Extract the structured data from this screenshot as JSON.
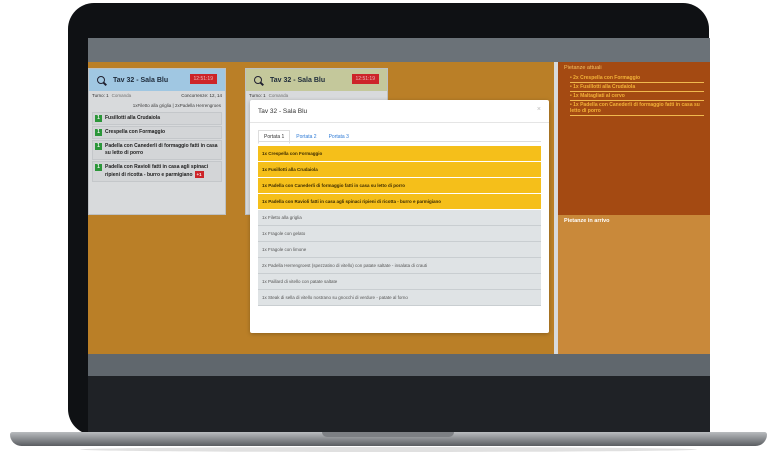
{
  "left_card": {
    "title": "Tav 32 - Sala Blu",
    "time_badge": "12:51:19",
    "turno": "Turno: 1",
    "comanda": "Comanda",
    "concorrenze": "Concorrenze: 12, 14",
    "summary": "1xFiletto alla griglia | 2xPadella Herrengroes",
    "dishes": [
      {
        "qty": "1",
        "name": "Fusillotti alla Crudaiola"
      },
      {
        "qty": "1",
        "name": "Crespella con Formaggio"
      },
      {
        "qty": "1",
        "name": "Padella con Canederli di formaggio fatti in casa su letto di porro"
      },
      {
        "qty": "1",
        "name": "Padella con Ravioli fatti in casa agli spinaci ripieni di ricotta - burro e parmigiano",
        "badge": "+1"
      }
    ]
  },
  "mid_card": {
    "title": "Tav 32 - Sala Blu",
    "time_badge": "12:51:19",
    "turno": "Turno: 1",
    "comanda": "Comanda"
  },
  "right_panel": {
    "attuali_title": "Pietanze attuali",
    "attuali_items": [
      "2x Crespella con Formaggio",
      "1x Fusillotti alla Crudaiola",
      "1x Maltagliati al cervo",
      "1x Padella con Canederli di formaggio fatti in casa su letto di porro"
    ],
    "arrivo_title": "Pietanze in arrivo"
  },
  "modal": {
    "title": "Tav 32 - Sala Blu",
    "close": "×",
    "tabs": [
      "Portata 1",
      "Portata 2",
      "Portata 3"
    ],
    "rows": [
      {
        "text": "1x Crespella con Formaggio",
        "highlight": true
      },
      {
        "text": "1x Fusillotti alla Crudaiola",
        "highlight": true
      },
      {
        "text": "1x Padella con Canederli di formaggio fatti in casa su letto di porro",
        "highlight": true
      },
      {
        "text": "1x Padella con Ravioli fatti in casa agli spinaci ripieni di ricotta - burro e parmigiano",
        "highlight": true
      },
      {
        "text": "1x Filetto alla griglia",
        "highlight": false
      },
      {
        "text": "1x Fragole con gelato",
        "highlight": false
      },
      {
        "text": "1x Fragole con limone",
        "highlight": false
      },
      {
        "text": "2x Padella Herrengroest (spezzatino di vitello) con patate saltate - insalata di crauti",
        "highlight": false
      },
      {
        "text": "1x Paillard di vitello con patate saltate",
        "highlight": false
      },
      {
        "text": "1x Steak di sella di vitello nostrano su gnocchi di verdure - patate al forno",
        "highlight": false
      }
    ]
  },
  "colors": {
    "highlight_row": "#f5bf1a",
    "time_badge": "#d9262c",
    "qty_badge": "#2e9f3d",
    "attuali_bg": "#a44a12"
  }
}
